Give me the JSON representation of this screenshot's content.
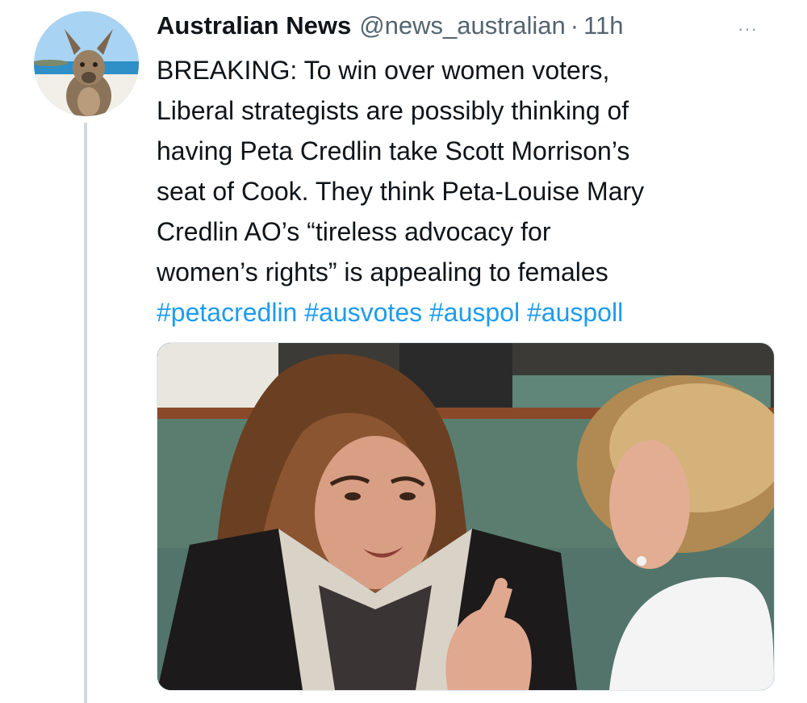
{
  "author": {
    "name": "Australian News",
    "handle": "@news_australian",
    "separator": "·",
    "time": "11h"
  },
  "more_button": {
    "icon": "more-horizontal-icon",
    "label": "···"
  },
  "tweet": {
    "lines": [
      "BREAKING: To win over women voters,",
      "Liberal strategists are possibly thinking of",
      "having Peta Credlin take Scott Morrison’s",
      "seat of Cook. They think Peta-Louise Mary",
      "Credlin AO’s “tireless advocacy for",
      "women’s rights” is appealing to females"
    ],
    "hashtags": [
      "#petacredlin",
      "#ausvotes",
      "#auspol",
      "#auspoll"
    ]
  },
  "colors": {
    "link": "#1d9bf0",
    "text": "#0f1419",
    "muted": "#536471",
    "thread_line": "#cfd9de"
  }
}
